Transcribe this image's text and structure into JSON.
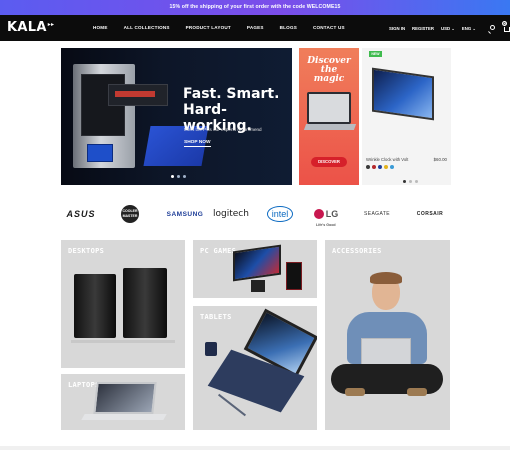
{
  "promo_bar": {
    "text": "15% off the shipping of your first order with the code WELCOME15"
  },
  "nav": {
    "logo": "KALA",
    "menu": [
      "HOME",
      "ALL COLLECTIONS",
      "PRODUCT LAYOUT",
      "PAGES",
      "BLOGS",
      "CONTACT US"
    ],
    "sign_in": "SIGN IN",
    "register": "REGISTER",
    "currency": "USD ⌄",
    "language": "ENG ⌄",
    "cart_count": "0"
  },
  "hero": {
    "headline_line1": "Fast. Smart.",
    "headline_line2": "Hard-working.",
    "subtitle": "Meet the PCs our experts recommend",
    "cta": "SHOP NOW",
    "slides": 3,
    "active_slide": 1
  },
  "side_promo": {
    "title_line1": "Discover",
    "title_line2": "the magic",
    "cta": "DISCOVER"
  },
  "featured_product": {
    "badge": "NEW",
    "name": "Wrinkle Clock with Volt",
    "price": "$60.00",
    "swatches": [
      "#3a3a3a",
      "#b4282c",
      "#1f3f9c",
      "#e3b21e",
      "#3a9bd6"
    ],
    "slides": 3,
    "active_slide": 1
  },
  "brands": [
    "ASUS",
    "COOLER MASTER",
    "SAMSUNG",
    "logitech",
    "intel",
    "LG",
    "SEAGATE",
    "CORSAIR"
  ],
  "brand_lg_tagline": "Life's Good",
  "categories": {
    "desktops": "DESKTOPS",
    "laptops": "LAPTOPS",
    "pc_games": "PC GAMES",
    "tablets": "TABLETS",
    "accessories": "ACCESSORIES"
  },
  "colors": {
    "promo_gradient_start": "#5b5cf0",
    "promo_gradient_end": "#3a78f2",
    "nav_bg": "#0c0c0c",
    "hero_bg": "#0d1628",
    "side_promo_bg": "#ec5248",
    "badge_new": "#3fbb4e",
    "tile_bg": "#d8d8d8"
  }
}
